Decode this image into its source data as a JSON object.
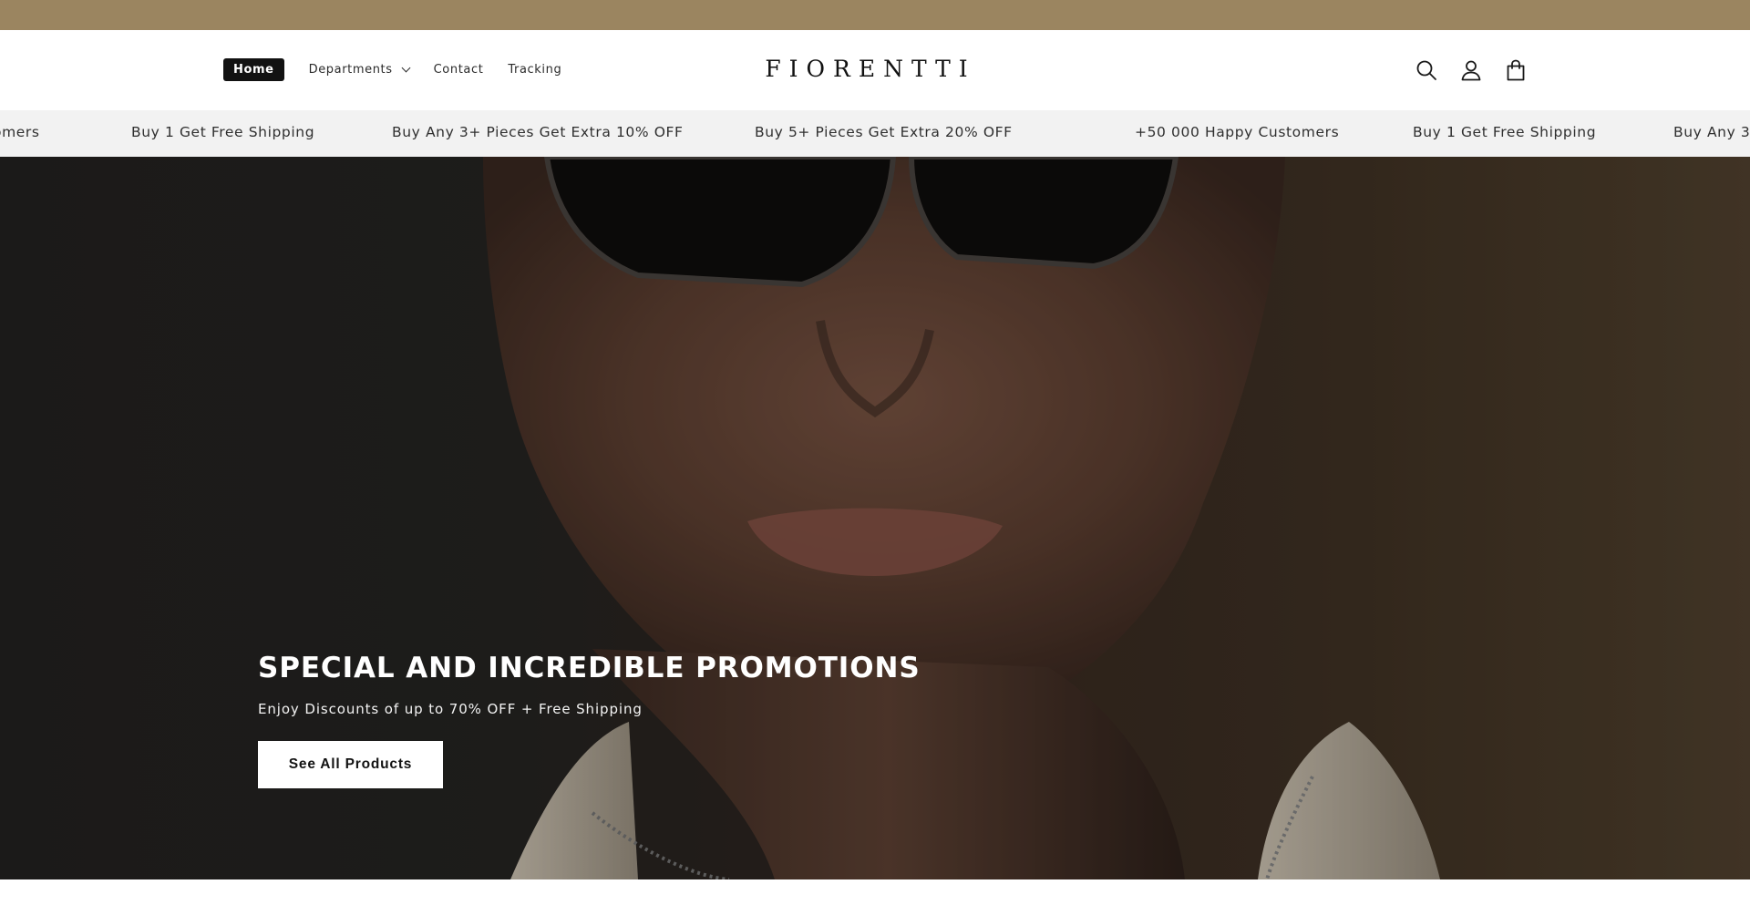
{
  "colors": {
    "top_strip": "#9b8560",
    "announcement_bg": "#f2f2f2",
    "nav_active_bg": "#121212",
    "hero_text": "#ffffff",
    "button_bg": "#ffffff"
  },
  "header": {
    "nav": [
      {
        "label": "Home",
        "active": true
      },
      {
        "label": "Departments",
        "has_dropdown": true
      },
      {
        "label": "Contact"
      },
      {
        "label": "Tracking"
      }
    ],
    "logo": "FIORENTTI",
    "icons": [
      "search-icon",
      "account-icon",
      "cart-icon"
    ]
  },
  "announcement_bar": {
    "items": [
      "omers",
      "Buy 1 Get Free Shipping",
      "Buy Any 3+ Pieces Get Extra 10% OFF",
      "Buy 5+ Pieces Get Extra 20% OFF",
      "+50 000 Happy Customers",
      "Buy 1 Get Free Shipping",
      "Buy Any 3+"
    ]
  },
  "hero": {
    "title": "SPECIAL AND INCREDIBLE PROMOTIONS",
    "subtitle": "Enjoy Discounts of up to 70% OFF + Free Shipping",
    "button_label": "See All Products"
  }
}
